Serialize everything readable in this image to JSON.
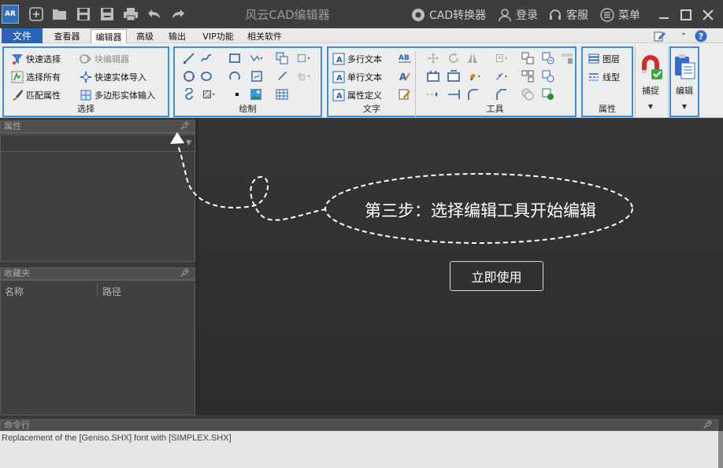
{
  "window": {
    "title": "风云CAD编辑器",
    "converter_label": "CAD转换器",
    "login_label": "登录",
    "service_label": "客服",
    "menu_label": "菜单"
  },
  "menubar": {
    "file": "文件",
    "tabs": [
      "查看器",
      "编辑器",
      "高级",
      "输出",
      "VIP功能",
      "相关软件"
    ],
    "active_tab": "编辑器"
  },
  "ribbon": {
    "select": {
      "label": "选择",
      "quick_select": "快速选择",
      "block_editor": "块编辑器",
      "select_all": "选择所有",
      "quick_entity_import": "快速实体导入",
      "match_properties": "匹配属性",
      "polygon_entity_input": "多边形实体输入"
    },
    "draw": {
      "label": "绘制"
    },
    "text": {
      "label": "文字",
      "multiline_text": "多行文本",
      "single_line_text": "单行文本",
      "attribute_definition": "属性定义"
    },
    "tools": {
      "label": "工具"
    },
    "properties": {
      "label": "属性",
      "layers": "图层",
      "linetype": "线型"
    },
    "snap": {
      "label": "捕捉"
    },
    "edit": {
      "label": "编辑"
    }
  },
  "panels": {
    "properties_title": "属性",
    "favorites_title": "收藏夹",
    "favorites_columns": [
      "名称",
      "路径"
    ]
  },
  "canvas": {
    "step_text": "第三步：选择编辑工具开始编辑",
    "use_now_button": "立即使用"
  },
  "command_line": {
    "title": "命令行",
    "log": "Replacement of the [Geniso.SHX] font with [SIMPLEX.SHX]"
  },
  "colors": {
    "accent_blue": "#3b8fe0",
    "file_tab": "#2b63b8",
    "title_bar": "#3d3d3d",
    "canvas_bg": "#333333"
  }
}
